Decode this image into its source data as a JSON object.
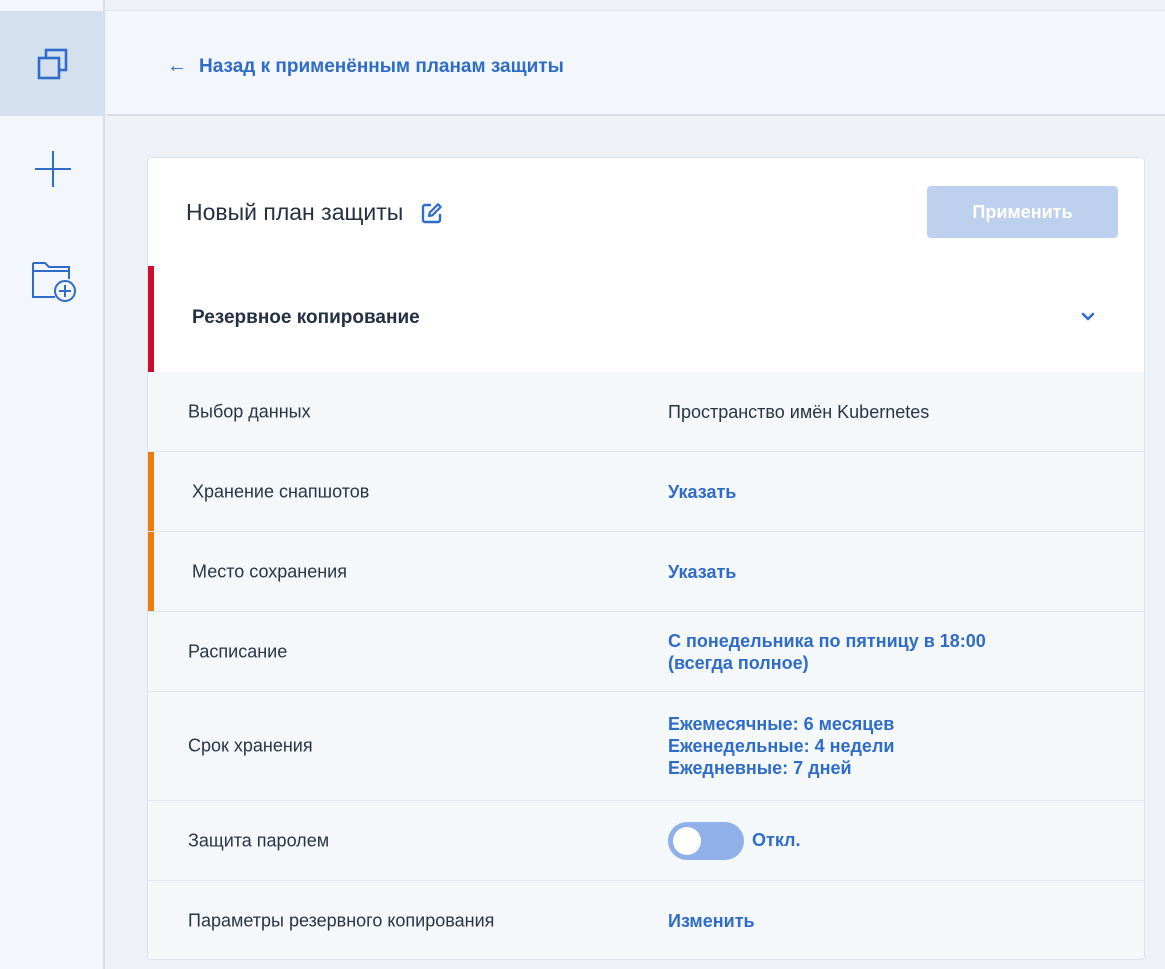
{
  "header": {
    "back_label": "Назад к применённым планам защиты"
  },
  "plan": {
    "name": "Новый план защиты",
    "apply_label": "Применить"
  },
  "section": {
    "title": "Резервное копирование"
  },
  "rows": [
    {
      "label": "Выбор данных",
      "value": "Пространство имён Kubernetes"
    },
    {
      "label": "Хранение снапшотов",
      "value": "Указать"
    },
    {
      "label": "Место сохранения",
      "value": "Указать"
    },
    {
      "label": "Расписание",
      "value_lines": [
        "С понедельника по пятницу в 18:00",
        "(всегда полное)"
      ]
    },
    {
      "label": "Срок хранения",
      "value_lines": [
        "Ежемесячные: 6 месяцев",
        "Еженедельные: 4 недели",
        "Ежедневные: 7 дней"
      ]
    },
    {
      "label": "Защита паролем",
      "toggle_state": "Откл."
    },
    {
      "label": "Параметры резервного копирования",
      "value": "Изменить"
    }
  ],
  "colors": {
    "accent_link": "#2e6cc7",
    "section_marker": "#c8102e",
    "warning_marker": "#f07a0a",
    "apply_disabled": "#bdd0ee"
  },
  "icons": {
    "rail": [
      "overlap-squares-icon",
      "plus-icon",
      "folder-add-icon"
    ],
    "edit": "pencil-edit-icon",
    "expand": "chevron-down-icon"
  }
}
